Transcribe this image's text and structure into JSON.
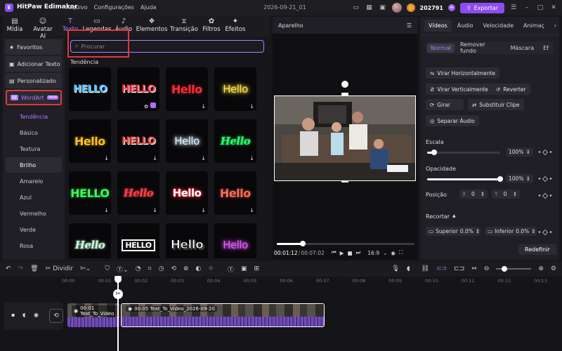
{
  "app": {
    "name": "HitPaw Edimakor",
    "project_title": "2026-09-21_01"
  },
  "menu": [
    "Arquivo",
    "Configurações",
    "Ajuda"
  ],
  "header": {
    "credits": "202791",
    "export_label": "Exportar"
  },
  "library_tabs": [
    {
      "label": "Mídia",
      "icon": "media-icon"
    },
    {
      "label": "Avatar AI",
      "icon": "avatar-ai-icon"
    },
    {
      "label": "Texto",
      "icon": "text-icon",
      "active": true
    },
    {
      "label": "Legendas",
      "icon": "captions-icon"
    },
    {
      "label": "Áudio",
      "icon": "audio-icon"
    },
    {
      "label": "Elementos",
      "icon": "elements-icon"
    },
    {
      "label": "Transição",
      "icon": "transition-icon"
    },
    {
      "label": "Filtros",
      "icon": "filters-icon"
    },
    {
      "label": "Efeitos",
      "icon": "effects-icon"
    }
  ],
  "sidebar": {
    "items": [
      {
        "label": "Favoritos",
        "icon": "star-icon"
      },
      {
        "label": "Adicionar Texto",
        "icon": "add-text-icon"
      },
      {
        "label": "Personalizado",
        "icon": "custom-icon"
      },
      {
        "label": "WordArt",
        "icon": "wordart-icon",
        "badge": "NEW"
      }
    ],
    "subitems": [
      "Tendência",
      "Básico",
      "Textura",
      "Brilho",
      "Amarelo",
      "Azul",
      "Vermelho",
      "Verde",
      "Rosa"
    ],
    "active_sub": "Tendência",
    "selected_sub": "Brilho"
  },
  "search": {
    "placeholder": "Procurar"
  },
  "section_label": "Tendência",
  "tiles": [
    {
      "text": "HELLO",
      "color": "#4fb6ff",
      "style": "3d",
      "marker": "none"
    },
    {
      "text": "HELLO",
      "color": "#ff3b4e",
      "style": "3d",
      "marker": "pro"
    },
    {
      "text": "Hello",
      "color": "#ff2a3c",
      "style": "bold",
      "marker": "download"
    },
    {
      "text": "Hello",
      "color": "#ffe14a",
      "style": "glow",
      "marker": "download"
    },
    {
      "text": "Hello",
      "color": "#ffc21a",
      "style": "bold",
      "marker": "download"
    },
    {
      "text": "HELLO",
      "color": "#e8463a",
      "style": "3d",
      "marker": "download"
    },
    {
      "text": "Hello",
      "color": "#d8f3ff",
      "style": "glow",
      "marker": "download"
    },
    {
      "text": "Hello",
      "color": "#2bff6a",
      "style": "script",
      "marker": "download"
    },
    {
      "text": "HELLO",
      "color": "#38ff5a",
      "style": "bold",
      "marker": "download"
    },
    {
      "text": "Hello",
      "color": "#ff3e4a",
      "style": "script",
      "marker": "download"
    },
    {
      "text": "Hello",
      "color": "#ffffff",
      "style": "glow-red",
      "marker": "download"
    },
    {
      "text": "Hello",
      "color": "#ff6a5a",
      "style": "bold",
      "marker": "download"
    },
    {
      "text": "Hello",
      "color": "#c9ffd9",
      "style": "script",
      "marker": "none"
    },
    {
      "text": "HELLO",
      "color": "#ffffff",
      "style": "outline",
      "marker": "none"
    },
    {
      "text": "Hello",
      "color": "#ffffff",
      "style": "3d-white",
      "marker": "none"
    },
    {
      "text": "Hello",
      "color": "#e25bff",
      "style": "glow",
      "marker": "none"
    }
  ],
  "player": {
    "title": "Aparelho",
    "time_current": "00:01:12",
    "time_total": "00:07:02",
    "progress": 0.19,
    "aspect": "16:9"
  },
  "properties": {
    "tabs": [
      "Vídeos",
      "Áudio",
      "Velocidade",
      "Animaç"
    ],
    "active_tab": "Vídeos",
    "subtabs": [
      "Normal",
      "Remover fundo",
      "Máscara",
      "Ef"
    ],
    "active_subtab": "Normal",
    "buttons": [
      {
        "label": "Virar Horizontalmente",
        "icon": "flip-horizontal-icon"
      },
      {
        "label": "Virar Verticalmente",
        "icon": "flip-vertical-icon"
      },
      {
        "label": "Reverter",
        "icon": "reverse-icon"
      },
      {
        "label": "Girar",
        "icon": "rotate-icon"
      },
      {
        "label": "Substituir Clipe",
        "icon": "replace-clip-icon"
      },
      {
        "label": "Separar Áudio",
        "icon": "separate-audio-icon"
      }
    ],
    "scale": {
      "label": "Escala",
      "value": "100%",
      "fraction": 0.1
    },
    "opacity": {
      "label": "Opacidade",
      "value": "100%",
      "fraction": 1.0
    },
    "position": {
      "label": "Posição",
      "x_label": "X",
      "x": "0",
      "y_label": "Y",
      "y": "0"
    },
    "crop": {
      "label": "Recortar",
      "top_label": "Superior",
      "top": "0.0%",
      "bottom_label": "Inferior",
      "bottom": "0.0%"
    },
    "reset_label": "Redefinir"
  },
  "toolbar": {
    "split_label": "Dividir"
  },
  "timeline": {
    "ruler": [
      "00:00",
      "00:01",
      "00:02",
      "00:03",
      "00:04",
      "00:05",
      "00:06",
      "00:07",
      "00:08",
      "00:09",
      "00:10",
      "00:11",
      "00:12",
      "00:13"
    ],
    "clips": [
      {
        "label": "00:01 Text_To_Video"
      },
      {
        "label": "00:05 Text_To_Video_2026-09-20"
      }
    ]
  }
}
